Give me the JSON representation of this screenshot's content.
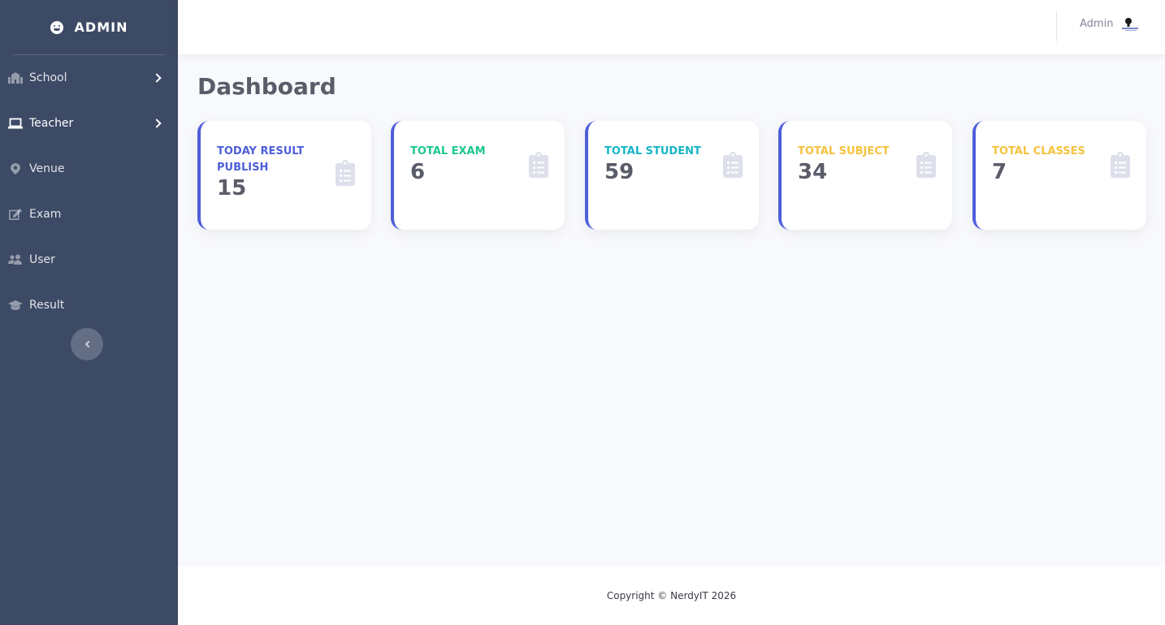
{
  "sidebar": {
    "brand": "ADMIN",
    "items": [
      {
        "label": "School",
        "icon": "school-icon"
      },
      {
        "label": "Teacher",
        "icon": "laptop-icon"
      },
      {
        "label": "Venue",
        "icon": "map-marker-icon"
      },
      {
        "label": "Exam",
        "icon": "edit-icon"
      },
      {
        "label": "User",
        "icon": "users-icon"
      },
      {
        "label": "Result",
        "icon": "graduation-cap-icon"
      }
    ]
  },
  "topbar": {
    "user_name": "Admin"
  },
  "main": {
    "title": "Dashboard",
    "cards": [
      {
        "label": "TODAY RESULT PUBLISH",
        "value": "15",
        "color": "#4e5fd9"
      },
      {
        "label": "TOTAL EXAM",
        "value": "6",
        "color": "#1cc88a"
      },
      {
        "label": "TOTAL STUDENT",
        "value": "59",
        "color": "#17b5c7"
      },
      {
        "label": "TOTAL SUBJECT",
        "value": "34",
        "color": "#f6c23e"
      },
      {
        "label": "TOTAL CLASSES",
        "value": "7",
        "color": "#f6c23e"
      }
    ]
  },
  "footer": {
    "copyright": "Copyright © NerdyIT 2026"
  },
  "colors": {
    "sidebar_bg": "#3d4a66",
    "card_border": "#4e5fd9",
    "icon_muted": "#dddfeb"
  }
}
